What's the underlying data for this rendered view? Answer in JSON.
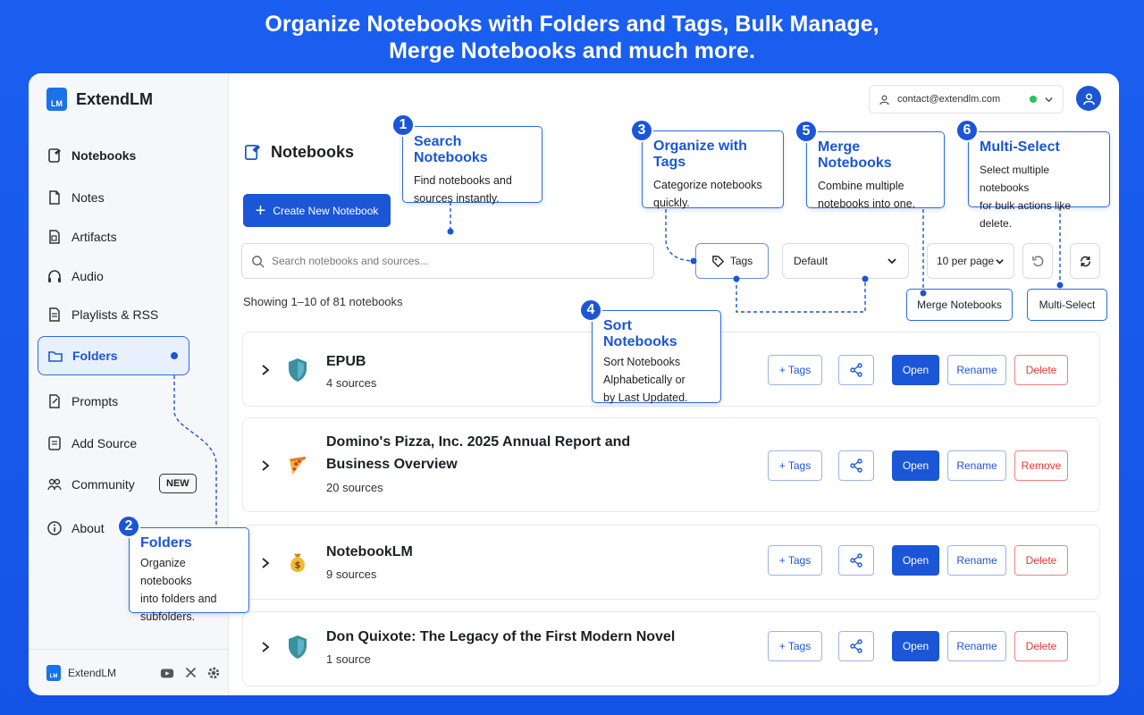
{
  "headline": {
    "line1": "Organize Notebooks with Folders and Tags, Bulk Manage,",
    "line2": "Merge Notebooks and much more."
  },
  "brand": {
    "name": "ExtendLM",
    "logo_text": "LM"
  },
  "sidebar": {
    "items": [
      {
        "label": "Notebooks",
        "icon": "notebook-icon"
      },
      {
        "label": "Notes",
        "icon": "note-icon"
      },
      {
        "label": "Artifacts",
        "icon": "artifact-icon"
      },
      {
        "label": "Audio",
        "icon": "headphones-icon"
      },
      {
        "label": "Playlists & RSS",
        "icon": "playlist-icon"
      },
      {
        "label": "Folders",
        "icon": "folder-icon"
      },
      {
        "label": "Prompts",
        "icon": "prompt-icon"
      },
      {
        "label": "Add Source",
        "icon": "add-source-icon"
      },
      {
        "label": "Community",
        "icon": "community-icon",
        "badge": "NEW"
      },
      {
        "label": "About",
        "icon": "info-icon"
      }
    ],
    "footer_name": "ExtendLM"
  },
  "account": {
    "email": "contact@extendlm.com",
    "status_color": "#22c55e"
  },
  "main": {
    "title": "Notebooks",
    "create_button": "Create New Notebook",
    "search_placeholder": "Search notebooks and sources...",
    "tags_button": "Tags",
    "sort_value": "Default",
    "per_page_value": "10 per page",
    "merge_button": "Merge Notebooks",
    "multiselect_button": "Multi-Select",
    "showing": "Showing 1–10 of 81 notebooks"
  },
  "notebooks": [
    {
      "title": "EPUB",
      "sources": "4 sources",
      "icon": "shield-icon",
      "last_action": "Delete"
    },
    {
      "title": "Domino's Pizza, Inc. 2025 Annual Report and",
      "title2": "Business Overview",
      "sources": "20 sources",
      "icon": "pizza-icon",
      "last_action": "Remove"
    },
    {
      "title": "NotebookLM",
      "sources": "9 sources",
      "icon": "money-bag-icon",
      "last_action": "Delete"
    },
    {
      "title": "Don Quixote: The Legacy of the First Modern Novel",
      "sources": "1 source",
      "icon": "shield-icon",
      "last_action": "Delete"
    }
  ],
  "row_actions": {
    "tags": "+ Tags",
    "open": "Open",
    "rename": "Rename"
  },
  "callouts": [
    {
      "num": "1",
      "title": "Search Notebooks",
      "desc1": "Find notebooks and",
      "desc2": "sources instantly."
    },
    {
      "num": "2",
      "title": "Folders",
      "desc1": "Organize notebooks",
      "desc2": "into folders and",
      "desc3": "subfolders."
    },
    {
      "num": "3",
      "title": "Organize with Tags",
      "desc1": "Categorize notebooks",
      "desc2": "quickly."
    },
    {
      "num": "4",
      "title": "Sort Notebooks",
      "desc1": "Sort Notebooks",
      "desc2": "Alphabetically or",
      "desc3": "by Last Updated."
    },
    {
      "num": "5",
      "title": "Merge Notebooks",
      "desc1": "Combine multiple",
      "desc2": "notebooks into one."
    },
    {
      "num": "6",
      "title": "Multi-Select",
      "desc1": "Select multiple notebooks",
      "desc2": "for bulk actions like delete."
    }
  ],
  "colors": {
    "accent": "#1a56d6",
    "background": "#1553e6",
    "danger": "#e53935"
  }
}
